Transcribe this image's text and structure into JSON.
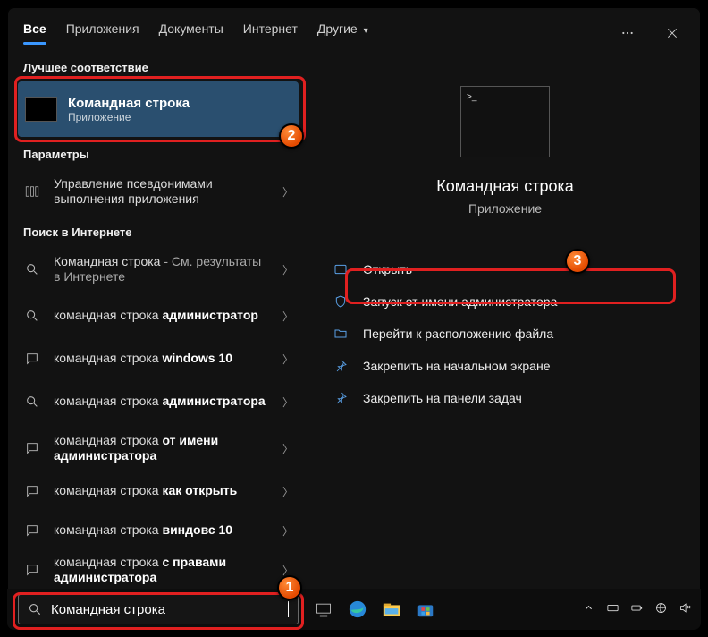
{
  "tabs": {
    "all": "Все",
    "apps": "Приложения",
    "docs": "Документы",
    "internet": "Интернет",
    "other": "Другие"
  },
  "sections": {
    "bestMatch": "Лучшее соответствие",
    "settings": "Параметры",
    "webSearch": "Поиск в Интернете"
  },
  "bestMatch": {
    "title": "Командная строка",
    "subtitle": "Приложение"
  },
  "settingsItem": {
    "text": "Управление псевдонимами выполнения приложения"
  },
  "web": {
    "item1_prefix": "Командная строка",
    "item1_suffix": " - См. результаты в Интернете",
    "item2_a": "командная строка ",
    "item2_b": "администратор",
    "item3_a": "командная строка ",
    "item3_b": "windows 10",
    "item4_a": "командная строка ",
    "item4_b": "администратора",
    "item5_a": "командная строка ",
    "item5_b": "от имени администратора",
    "item6_a": "командная строка ",
    "item6_b": "как открыть",
    "item7_a": "командная строка ",
    "item7_b": "виндовс 10",
    "item8_a": "командная строка ",
    "item8_b": "с правами администратора"
  },
  "detail": {
    "title": "Командная строка",
    "subtitle": "Приложение",
    "actions": {
      "open": "Открыть",
      "runAsAdmin": "Запуск от имени администратора",
      "openLocation": "Перейти к расположению файла",
      "pinStart": "Закрепить на начальном экране",
      "pinTaskbar": "Закрепить на панели задач"
    }
  },
  "search": {
    "value": "Командная строка"
  },
  "annotations": {
    "n1": "1",
    "n2": "2",
    "n3": "3"
  }
}
